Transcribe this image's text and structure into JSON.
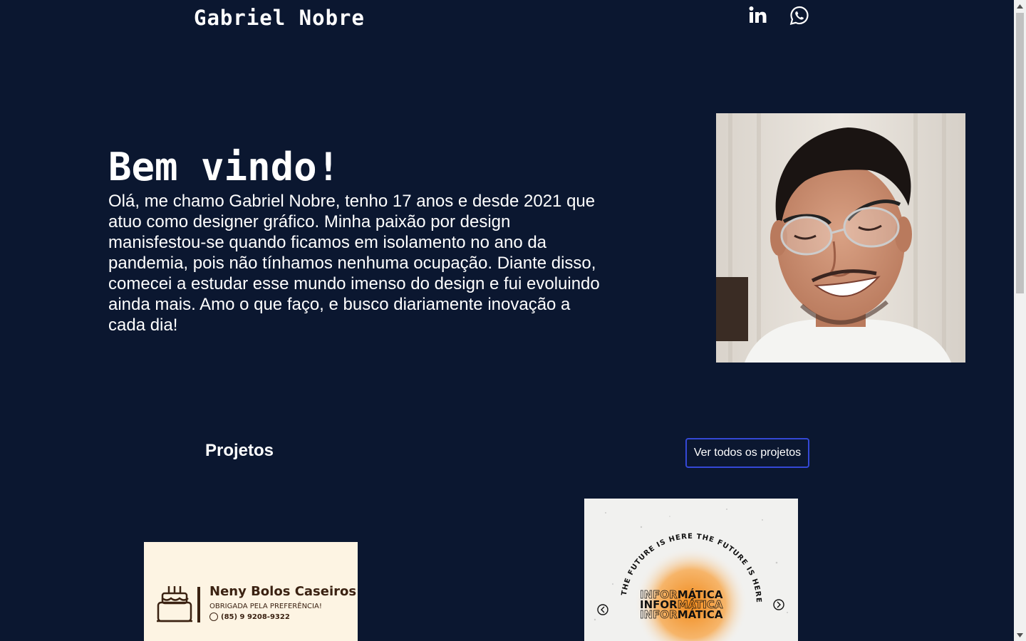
{
  "header": {
    "brand": "Gabriel Nobre",
    "social": [
      {
        "name": "linkedin-icon"
      },
      {
        "name": "whatsapp-icon"
      }
    ]
  },
  "hero": {
    "title": "Bem vindo!",
    "text": "Olá, me chamo Gabriel Nobre, tenho 17 anos e desde 2021 que atuo como designer gráfico. Minha paixão por design manisfestou-se quando ficamos em isolamento no ano da pandemia, pois não tínhamos nenhuma ocupação. Diante disso, comecei a estudar esse mundo imenso do design e fui evoluindo ainda mais. Amo o que faço, e busco diariamente inovação a cada dia!"
  },
  "projects": {
    "title": "Projetos",
    "view_all": "Ver todos os projetos",
    "items": [
      {
        "name": "Neny Bolos Caseiros",
        "line1": "OBRIGADA PELA PREFERÊNCIA!",
        "phone": "(85) 9 9208-9322"
      },
      {
        "ring": "THE FUTURE IS HERE THE FUTURE IS HERE",
        "row1": [
          "INFOR",
          "MÁTICA"
        ],
        "row2": [
          "INFOR",
          "MÁTICA"
        ],
        "row3": [
          "INFOR",
          "MÁTICA"
        ]
      }
    ]
  },
  "colors": {
    "background": "#0b1730",
    "button_border": "#3448d6",
    "card1_bg": "#fdf4e3",
    "card1_text": "#3b2212",
    "card2_accent": "#f08a1c"
  }
}
